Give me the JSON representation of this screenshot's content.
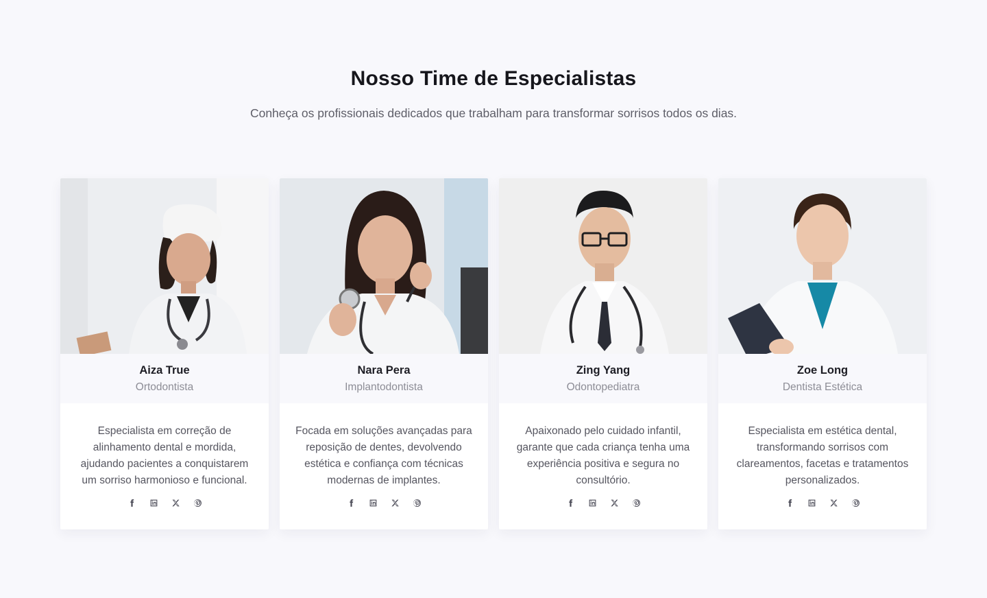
{
  "section": {
    "title": "Nosso Time de Especialistas",
    "subtitle": "Conheça os profissionais dedicados que trabalham para transformar sorrisos todos os dias."
  },
  "team": [
    {
      "name": "Aiza True",
      "role": "Ortodontista",
      "bio": "Especialista em correção de alinhamento dental e mordida, ajudando pacientes a conquistarem um sorriso harmonioso e funcional.",
      "photo": "doctor-portrait-woman-with-cap",
      "social": [
        "facebook-icon",
        "linkedin-icon",
        "x-icon",
        "pinterest-icon"
      ]
    },
    {
      "name": "Nara Pera",
      "role": "Implantodontista",
      "bio": "Focada em soluções avançadas para reposição de dentes, devolvendo estética e confiança com técnicas modernas de implantes.",
      "photo": "doctor-portrait-woman-with-stethoscope",
      "social": [
        "facebook-icon",
        "linkedin-icon",
        "x-icon",
        "pinterest-icon"
      ]
    },
    {
      "name": "Zing Yang",
      "role": "Odontopediatra",
      "bio": "Apaixonado pelo cuidado infantil, garante que cada criança tenha uma experiência positiva e segura no consultório.",
      "photo": "doctor-portrait-man-with-glasses",
      "social": [
        "facebook-icon",
        "linkedin-icon",
        "x-icon",
        "pinterest-icon"
      ]
    },
    {
      "name": "Zoe Long",
      "role": "Dentista Estética",
      "bio": "Especialista em estética dental, transformando sorrisos com clareamentos, facetas e tratamentos personalizados.",
      "photo": "doctor-portrait-woman-with-folder",
      "social": [
        "facebook-icon",
        "linkedin-icon",
        "x-icon",
        "pinterest-icon"
      ]
    }
  ],
  "colors": {
    "background": "#f8f8fc",
    "card": "#ffffff",
    "heading": "#16161c",
    "muted": "#8d8d96"
  }
}
